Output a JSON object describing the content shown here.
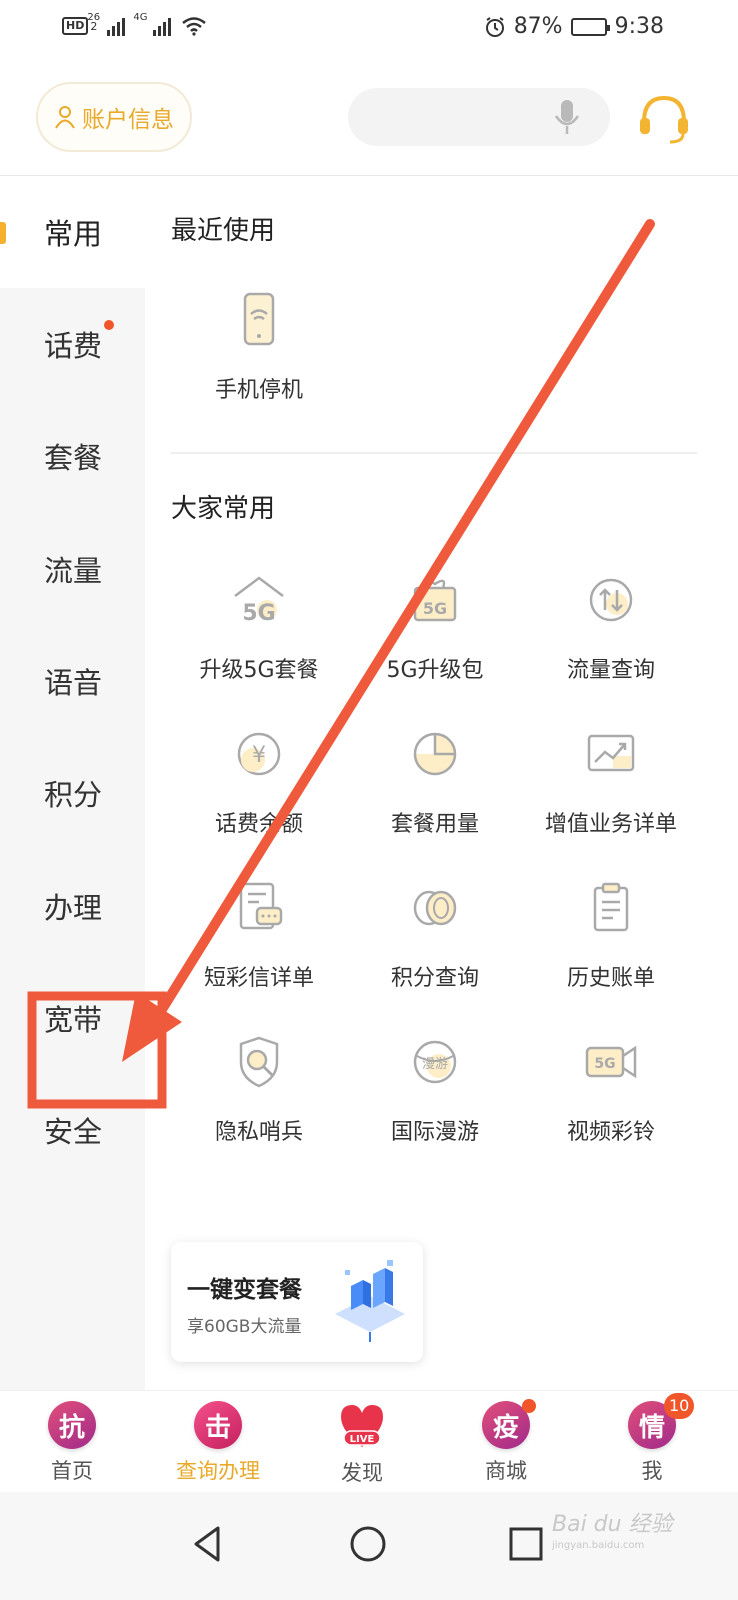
{
  "status_bar": {
    "hd": "HD",
    "hd_sub": "2",
    "net1": "26",
    "net2": "4G",
    "battery": "87%",
    "battery_level": 0.87,
    "time": "9:38"
  },
  "header": {
    "account_label": "账户信息",
    "search_placeholder": ""
  },
  "sidebar": {
    "items": [
      {
        "label": "常用",
        "active": true
      },
      {
        "label": "话费",
        "badge": true
      },
      {
        "label": "套餐"
      },
      {
        "label": "流量"
      },
      {
        "label": "语音"
      },
      {
        "label": "积分"
      },
      {
        "label": "办理"
      },
      {
        "label": "宽带",
        "annotated": true
      },
      {
        "label": "安全"
      }
    ]
  },
  "main": {
    "recent_title": "最近使用",
    "recent_items": [
      {
        "label": "手机停机",
        "icon": "phone-stop-icon"
      }
    ],
    "common_title": "大家常用",
    "common_items": [
      {
        "label": "升级5G套餐",
        "icon": "5g-house-icon",
        "icon_text": "5G"
      },
      {
        "label": "5G升级包",
        "icon": "5g-gift-icon",
        "icon_text": "5G"
      },
      {
        "label": "流量查询",
        "icon": "data-arrows-icon"
      },
      {
        "label": "话费余额",
        "icon": "yuan-coin-icon",
        "icon_text": "¥"
      },
      {
        "label": "套餐用量",
        "icon": "pie-chart-icon"
      },
      {
        "label": "增值业务详单",
        "icon": "trend-chart-icon"
      },
      {
        "label": "短彩信详单",
        "icon": "sms-doc-icon"
      },
      {
        "label": "积分查询",
        "icon": "coins-icon"
      },
      {
        "label": "历史账单",
        "icon": "clipboard-icon"
      },
      {
        "label": "隐私哨兵",
        "icon": "shield-search-icon"
      },
      {
        "label": "国际漫游",
        "icon": "globe-roam-icon",
        "icon_text": "漫游"
      },
      {
        "label": "视频彩铃",
        "icon": "5g-video-icon",
        "icon_text": "5G"
      }
    ],
    "promo": {
      "title": "一键变套餐",
      "subtitle": "享60GB大流量"
    }
  },
  "bottom_nav": {
    "items": [
      {
        "glyph": "抗",
        "label": "首页"
      },
      {
        "glyph": "击",
        "label": "查询办理",
        "active": true
      },
      {
        "glyph": "LIVE",
        "label": "发现"
      },
      {
        "glyph": "疫",
        "label": "商城",
        "dot": true
      },
      {
        "glyph": "情",
        "label": "我",
        "count": "10"
      }
    ]
  },
  "watermark": {
    "text": "Bai du 经验",
    "sub": "jingyan.baidu.com"
  },
  "colors": {
    "accent": "#e9a92a",
    "annotation": "#f05a3c",
    "badge": "#f0562a"
  }
}
